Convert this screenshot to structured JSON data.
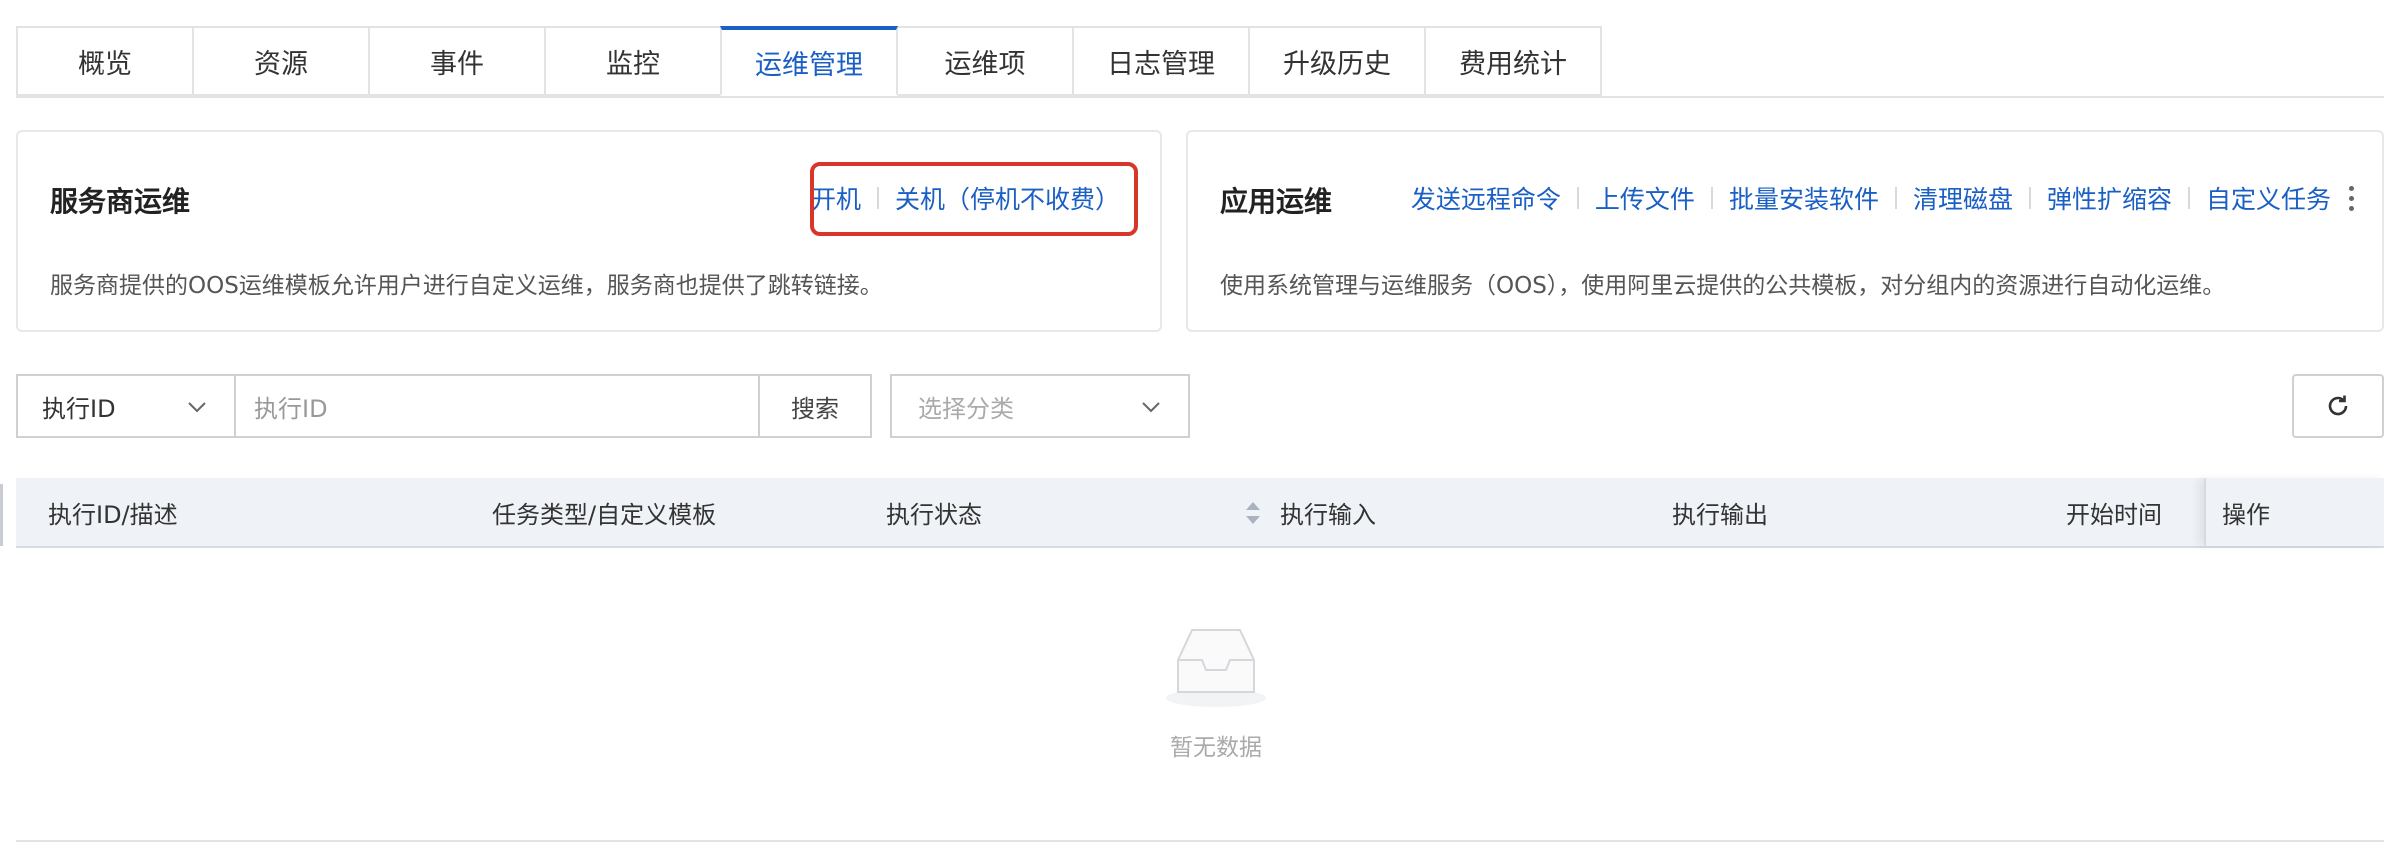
{
  "tabs": [
    {
      "label": "概览"
    },
    {
      "label": "资源"
    },
    {
      "label": "事件"
    },
    {
      "label": "监控"
    },
    {
      "label": "运维管理",
      "active": true
    },
    {
      "label": "运维项"
    },
    {
      "label": "日志管理"
    },
    {
      "label": "升级历史"
    },
    {
      "label": "费用统计"
    }
  ],
  "provider_ops": {
    "title": "服务商运维",
    "links": [
      "开机",
      "关机（停机不收费）"
    ],
    "description": "服务商提供的OOS运维模板允许用户进行自定义运维，服务商也提供了跳转链接。"
  },
  "app_ops": {
    "title": "应用运维",
    "links": [
      "发送远程命令",
      "上传文件",
      "批量安装软件",
      "清理磁盘",
      "弹性扩缩容",
      "自定义任务"
    ],
    "description": "使用系统管理与运维服务（OOS），使用阿里云提供的公共模板，对分组内的资源进行自动化运维。"
  },
  "filter": {
    "field_select": "执行ID",
    "search_placeholder": "执行ID",
    "search_button": "搜索",
    "category_placeholder": "选择分类"
  },
  "table": {
    "columns": [
      "执行ID/描述",
      "任务类型/自定义模板",
      "执行状态",
      "执行输入",
      "执行输出",
      "开始时间",
      "操作"
    ],
    "empty_text": "暂无数据"
  },
  "colors": {
    "accent": "#1a5fc4",
    "highlight": "#d9362b"
  }
}
